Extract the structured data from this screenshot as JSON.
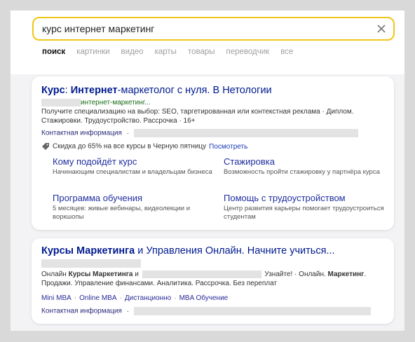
{
  "search": {
    "query": "курс интернет маркетинг"
  },
  "tabs": [
    {
      "label": "поиск",
      "active": true
    },
    {
      "label": "картинки"
    },
    {
      "label": "видео"
    },
    {
      "label": "карты"
    },
    {
      "label": "товары"
    },
    {
      "label": "переводчик"
    },
    {
      "label": "все"
    }
  ],
  "result1": {
    "title_b1": "Курс",
    "title_p1": ": ",
    "title_b2": "Интернет",
    "title_p2": "-маркетолог с нуля. В Нетологии",
    "url_text": "интернет-маркетинг...",
    "desc_line1": "Получите специализацию на выбор: SEO, таргетированная или контекстная реклама · Диплом.",
    "desc_line2": "Стажировки. Трудоустройство. Рассрочка · 16+",
    "contact_label": "Контактная информация",
    "contact_sep": "·",
    "promo_text": "Скидка до 65% на все курсы в Черную пятницу",
    "promo_link": "Посмотреть",
    "sitelinks": [
      {
        "title": "Кому подойдёт курс",
        "desc": "Начинающим специалистам и владельцам бизнеса"
      },
      {
        "title": "Стажировка",
        "desc": "Возможность пройти стажировку у партнёра курса"
      },
      {
        "title": "Программа обучения",
        "desc": "5 месяцев: живые вебинары, видеолекции и воркшопы"
      },
      {
        "title": "Помощь с трудоустройством",
        "desc": "Центр развития карьеры помогает трудоустроиться студентам"
      }
    ]
  },
  "result2": {
    "title_b1": "Курсы Маркетинга",
    "title_p1": " и Управления Онлайн. Начните учиться...",
    "desc_l1_a": "Онлайн ",
    "desc_l1_b": "Курсы Маркетинга",
    "desc_l1_c": " и",
    "desc_l1_d": "Узнайте! · Онлайн. ",
    "desc_l1_e": "Маркетинг",
    "desc_l1_f": ".",
    "desc_line2": "Продажи. Управление финансами. Аналитика. Рассрочка. Без переплат",
    "quick_links": [
      "Mini MBA",
      "Online MBA",
      "Дистанционно",
      "MBA Обучение"
    ],
    "contact_label": "Контактная информация",
    "contact_sep": "·"
  },
  "colors": {
    "search_border": "#f0c519",
    "title_link": "#001a8f",
    "sitelink": "#1f2f9f"
  }
}
